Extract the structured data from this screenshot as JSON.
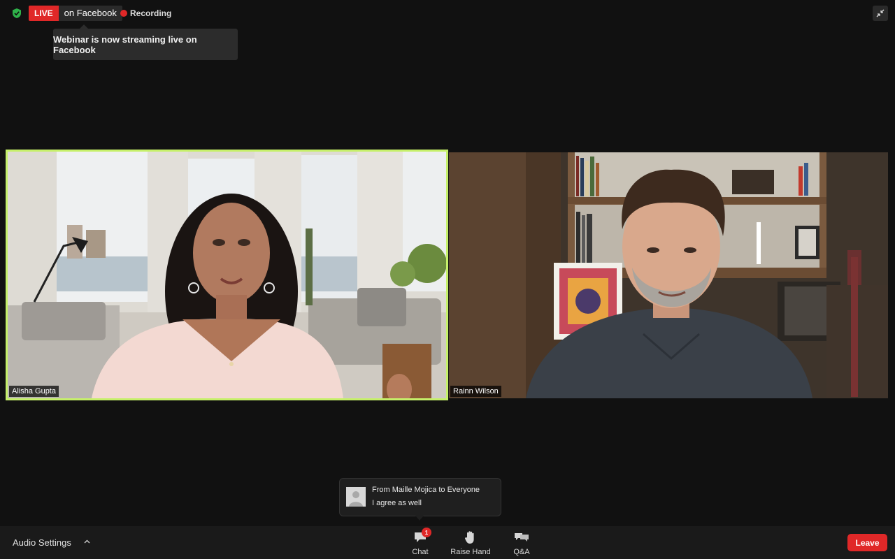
{
  "top_bar": {
    "live_label": "LIVE",
    "live_destination": "on Facebook",
    "recording_label": "Recording",
    "tooltip": "Webinar is now streaming live on Facebook"
  },
  "participants": [
    {
      "name": "Alisha Gupta",
      "active_speaker": true
    },
    {
      "name": "Rainn Wilson",
      "active_speaker": false
    }
  ],
  "chat_toast": {
    "from": "From Maille Mojica to Everyone",
    "message": "I agree as well"
  },
  "toolbar": {
    "audio_settings": "Audio Settings",
    "chat_label": "Chat",
    "chat_badge": "1",
    "raise_hand_label": "Raise Hand",
    "qa_label": "Q&A",
    "leave_label": "Leave"
  },
  "colors": {
    "live_red": "#e02828",
    "active_speaker_border": "#c6f06a",
    "background": "#111111"
  }
}
